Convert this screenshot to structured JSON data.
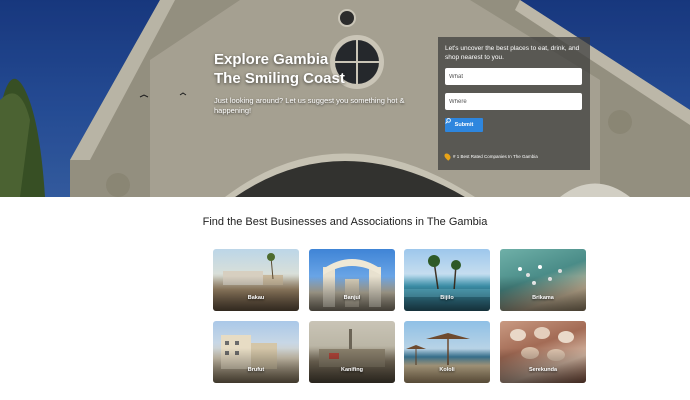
{
  "hero": {
    "title_line1": "Explore Gambia",
    "title_line2": "The Smiling Coast",
    "subtitle": "Just looking around? Let us suggest you something hot & happening!"
  },
  "search_panel": {
    "intro": "Let's uncover the best places to eat, drink, and shop nearest to you.",
    "what_placeholder": "What",
    "where_placeholder": "Where",
    "submit_label": "Submit",
    "companies_link": "# 1 Best Rated Companies In The Gambia"
  },
  "section": {
    "title": "Find the Best Businesses and Associations in The Gambia"
  },
  "locations": [
    {
      "name": "Bakau"
    },
    {
      "name": "Banjul"
    },
    {
      "name": "Bijilo"
    },
    {
      "name": "Brikama"
    },
    {
      "name": "Brufut"
    },
    {
      "name": "Kanifing"
    },
    {
      "name": "Kololi"
    },
    {
      "name": "Serekunda"
    }
  ],
  "icons": {
    "search": "search-icon",
    "pin": "map-pin-icon"
  }
}
